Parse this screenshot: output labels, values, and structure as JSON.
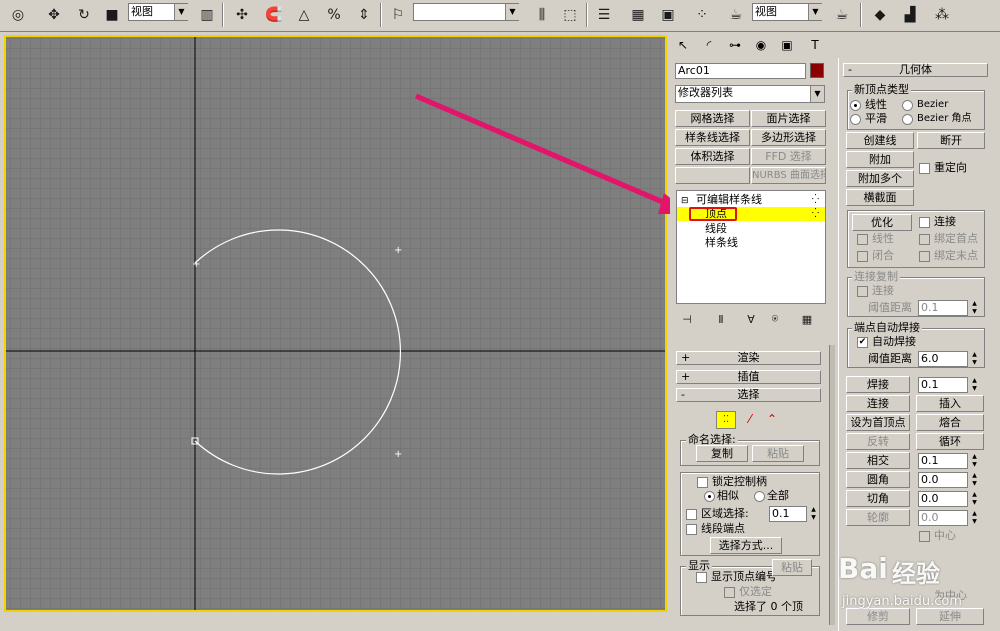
{
  "toolbar": {
    "view_combo_1": "视图",
    "view_combo_2": "视图",
    "named_selection": "",
    "icons": [
      "select-icon",
      "move-icon",
      "rotate-icon",
      "scale-icon",
      "mirror-icon",
      "snap-icon",
      "angle-snap-icon",
      "percent-snap-icon",
      "spinner-snap-icon",
      "edit-named-icon",
      "align-icon",
      "layer-icon",
      "curve-editor-icon",
      "schematic-icon",
      "material-editor-icon",
      "render-setup-icon",
      "render-icon"
    ]
  },
  "command_panel": {
    "object_name": "Arc01",
    "object_color": "#8b0000",
    "modifier_list": "修改器列表",
    "modifier_buttons": [
      "网格选择",
      "面片选择",
      "样条线选择",
      "多边形选择",
      "体积选择",
      "FFD 选择",
      "",
      "NURBS 曲面选择"
    ],
    "stack": {
      "root": "可编辑样条线",
      "items": [
        "顶点",
        "线段",
        "样条线"
      ]
    },
    "rollouts": {
      "render": "渲染",
      "interp": "插值",
      "select": "选择"
    },
    "named_sel": {
      "label": "命名选择:",
      "copy": "复制",
      "paste": "粘贴"
    },
    "lock_handles": "锁定控制柄",
    "similar": "相似",
    "all": "全部",
    "area_select": "区域选择:",
    "area_value": "0.1",
    "seg_end": "线段端点",
    "select_by": "选择方式...",
    "display": "显示",
    "show_vertex_num": "显示顶点编号",
    "only_selected": "仅选定",
    "paste_btn": "粘贴",
    "status": "选择了 0 个顶"
  },
  "geometry_panel": {
    "title": "几何体",
    "new_vertex_type": "新顶点类型",
    "linear": "线性",
    "bezier": "Bezier",
    "smooth": "平滑",
    "bezier_corner": "Bezier 角点",
    "create_line": "创建线",
    "break": "断开",
    "attach": "附加",
    "attach_mult": "附加多个",
    "reorient": "重定向",
    "cross_section": "横截面",
    "refine": "优化",
    "connect": "连接",
    "linear2": "线性",
    "bind_first": "绑定首点",
    "close": "闭合",
    "bind_last": "绑定末点",
    "connect_copy": "连接复制",
    "connect2": "连接",
    "threshold": "阈值距离",
    "threshold_val": "0.1",
    "end_auto_weld": "端点自动焊接",
    "auto_weld": "自动焊接",
    "threshold2": "阈值距离",
    "threshold2_val": "6.0",
    "weld": "焊接",
    "weld_val": "0.1",
    "connect3": "连接",
    "insert": "插入",
    "make_first": "设为首顶点",
    "fuse": "熔合",
    "reverse": "反转",
    "cycle": "循环",
    "cross_insert": "相交",
    "cross_val": "0.1",
    "fillet": "圆角",
    "fillet_val": "0.0",
    "chamfer": "切角",
    "chamfer_val": "0.0",
    "outline": "轮廓",
    "outline_val": "0.0",
    "center": "中心",
    "trim": "修剪",
    "extend": "延伸",
    "as_center": "为中心"
  },
  "watermark": {
    "brand": "Baidu经验",
    "url": "jingyan.baidu.com"
  }
}
